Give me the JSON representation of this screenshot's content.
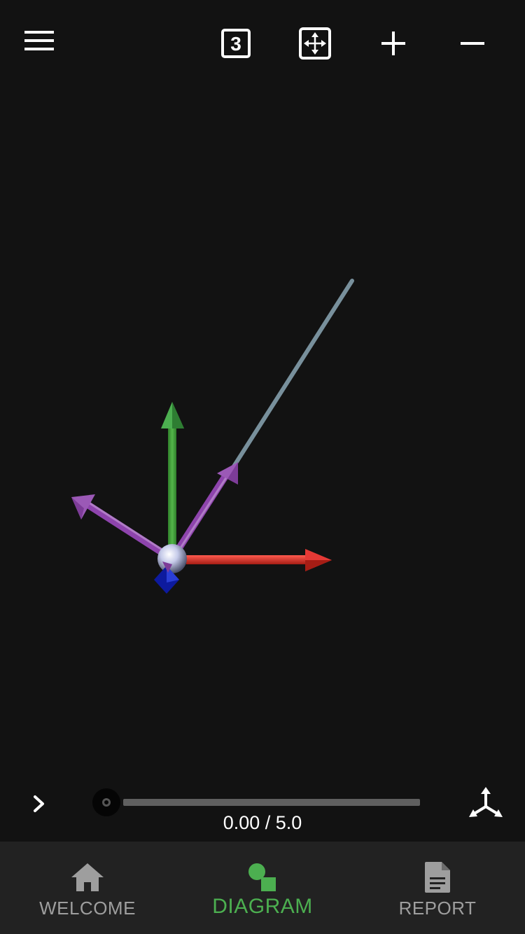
{
  "toolbar": {
    "menu_icon": "menu-icon",
    "view_3d_icon": "three-d-view-icon",
    "view_3d_label": "3",
    "fit_icon": "fit-view-icon",
    "zoom_in_icon": "plus-icon",
    "zoom_out_icon": "minus-icon"
  },
  "scene": {
    "colors": {
      "background": "#121212",
      "x_axis": "#e53935",
      "y_axis": "#43a047",
      "vector": "#9b59b6",
      "line": "#78909c",
      "node": "#c5cae9",
      "z_marker": "#0d1a9e"
    }
  },
  "playback": {
    "expand_icon": "chevron-right-icon",
    "current": "0.00",
    "separator": "/",
    "total": "5.0",
    "time_text": "0.00 / 5.0",
    "progress": 0,
    "axes_icon": "axes-triad-icon"
  },
  "nav": {
    "items": [
      {
        "label": "WELCOME",
        "icon": "home-icon",
        "active": false
      },
      {
        "label": "DIAGRAM",
        "icon": "diagram-icon",
        "active": true
      },
      {
        "label": "REPORT",
        "icon": "report-icon",
        "active": false
      }
    ],
    "colors": {
      "active": "#4caf50",
      "inactive": "#9e9e9e",
      "background": "#222222"
    }
  }
}
